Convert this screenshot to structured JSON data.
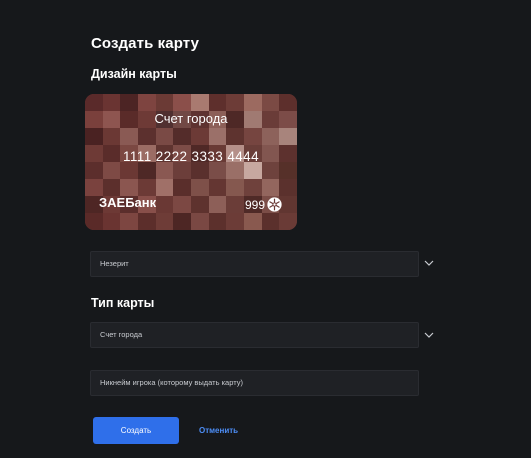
{
  "page": {
    "title": "Создать карту"
  },
  "design": {
    "title": "Дизайн карты"
  },
  "card": {
    "name": "Счет города",
    "number": "1111 2222 3333 4444",
    "bank": "ЗАЕБанк",
    "code": "999",
    "emblem_icon": "snowflake-icon",
    "tile_colors": [
      "#5a2a2a",
      "#6a3432",
      "#4c2424",
      "#7e4440",
      "#6b3a35",
      "#8b4f4a",
      "#a97a70",
      "#5e2f2c",
      "#6d3c37",
      "#9c6a60",
      "#7b4a44",
      "#5d2f2c",
      "#7a403c",
      "#8e5550",
      "#5a2b29",
      "#6e3a36",
      "#503030",
      "#714844",
      "#5e3230",
      "#8c5f58",
      "#4e2826",
      "#a07a72",
      "#6a3c38",
      "#7c4c48",
      "#4a2222",
      "#6b3834",
      "#8a5a54",
      "#5c302e",
      "#7a4a45",
      "#542c2a",
      "#6c3a36",
      "#9b7069",
      "#5e332f",
      "#764540",
      "#8d625b",
      "#a8847c",
      "#6e3a36",
      "#5a2c2a",
      "#7b4842",
      "#9b6c64",
      "#5f3430",
      "#7d4c47",
      "#4f2826",
      "#693a35",
      "#b59089",
      "#6a3e39",
      "#825650",
      "#5d312e",
      "#5c2e2c",
      "#7e4a45",
      "#6b3834",
      "#4e2826",
      "#8a5852",
      "#6c3e3a",
      "#5a302d",
      "#7a4d48",
      "#9a6f67",
      "#c7a8a0",
      "#6e423d",
      "#563029",
      "#7a423e",
      "#5c2f2c",
      "#8b5650",
      "#6c3a36",
      "#a07068",
      "#5a2e2b",
      "#7e5049",
      "#643632",
      "#85584f",
      "#6f413c",
      "#93665e",
      "#5b312d",
      "#4e2624",
      "#6d3935",
      "#5b2e2c",
      "#884f4a",
      "#6a3834",
      "#7c4843",
      "#5e322e",
      "#8d5f58",
      "#6b3d38",
      "#4f2a27",
      "#7b4d47",
      "#613631",
      "#5a2a28",
      "#6a3431",
      "#7d4641",
      "#5c2e2b",
      "#6e3c37",
      "#4d2624",
      "#7a4843",
      "#5c302c",
      "#6c3c37",
      "#89594f",
      "#5b302c",
      "#6a3b36"
    ]
  },
  "fields": {
    "nether": {
      "value": "Незерит"
    },
    "type_title": "Тип карты",
    "type": {
      "value": "Счет города"
    },
    "nickname": {
      "placeholder": "Никнейм игрока (которому выдать карту)"
    }
  },
  "icons": {
    "dropdown": "chevron-down-icon"
  },
  "actions": {
    "create_label": "Создать",
    "cancel_label": "Отменить"
  },
  "colors": {
    "background": "#16181b",
    "field_background": "#1f2125",
    "accent": "#2f6fea",
    "link": "#4d8ef7"
  }
}
